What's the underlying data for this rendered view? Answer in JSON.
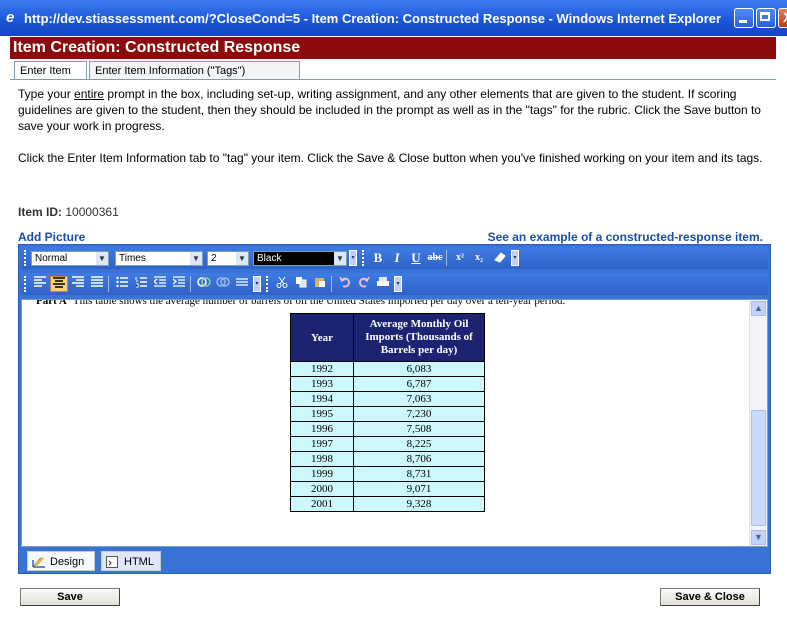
{
  "window": {
    "title": "http://dev.stiassessment.com/?CloseCond=5 - Item Creation: Constructed Response - Windows Internet Explorer"
  },
  "dialog": {
    "title": "Item Creation: Constructed Response",
    "tabs": [
      "Enter Item",
      "Enter Item Information (\"Tags\")"
    ],
    "instructions_1": "Type your entire prompt in the box, including set-up, writing assignment, and any other elements that are given to the student. If scoring guidelines are given to the student, then they should be included in the prompt as well as in the \"tags\" for the rubric. Click the Save button to save your work in progress.",
    "instructions_2": "Click the Enter Item Information tab to \"tag\" your item. Click the Save & Close button when you've finished working on your item and its tags.",
    "item_id_label": "Item ID:",
    "item_id": "10000361",
    "add_picture": "Add Picture",
    "example_link": "See an example of a constructed-response item."
  },
  "toolbar": {
    "paragraph_format": "Normal",
    "font_name": "Times",
    "font_size": "2",
    "font_color": "Black",
    "bold": "B",
    "italic": "I",
    "underline": "U",
    "strike": "abc",
    "superscript": "x²",
    "subscript": "x₂"
  },
  "content": {
    "part_label": "Part A",
    "part_text": "This table shows the average number of barrels of oil the United States imported per day over a ten-year period.",
    "table_headers": [
      "Year",
      "Average Monthly Oil Imports (Thousands of Barrels per day)"
    ],
    "rows": [
      [
        "1992",
        "6,083"
      ],
      [
        "1993",
        "6,787"
      ],
      [
        "1994",
        "7,063"
      ],
      [
        "1995",
        "7,230"
      ],
      [
        "1996",
        "7,508"
      ],
      [
        "1997",
        "8,225"
      ],
      [
        "1998",
        "8,706"
      ],
      [
        "1999",
        "8,731"
      ],
      [
        "2000",
        "9,071"
      ],
      [
        "2001",
        "9,328"
      ]
    ]
  },
  "modes": {
    "design": "Design",
    "html": "HTML"
  },
  "buttons": {
    "save": "Save",
    "save_close": "Save & Close"
  }
}
